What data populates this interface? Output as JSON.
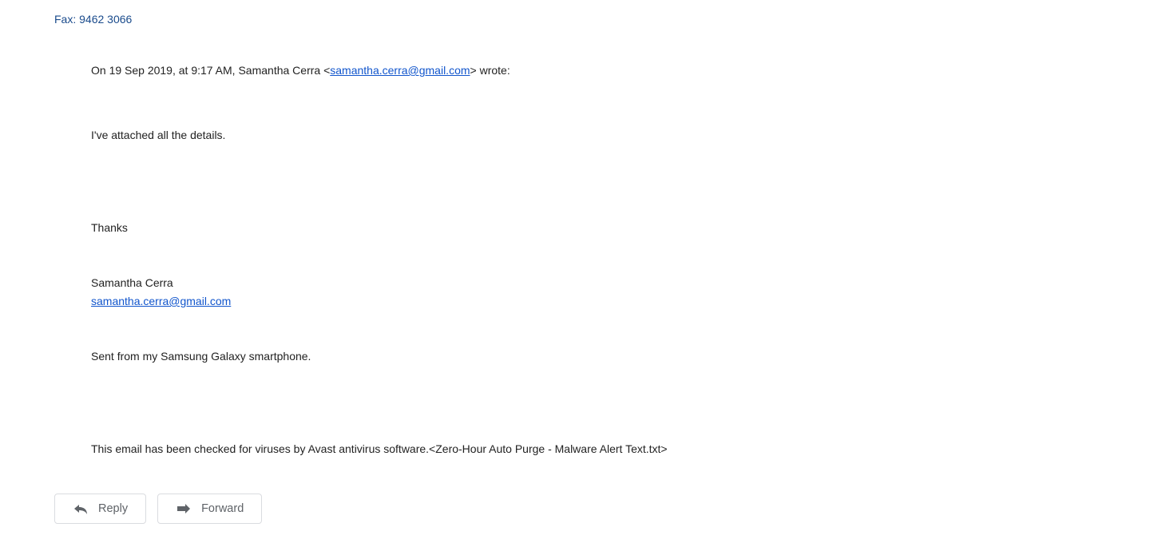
{
  "header": {
    "fax_line": "Fax: 9462 3066"
  },
  "quote": {
    "prefix": "On 19 Sep 2019, at 9:17 AM, Samantha Cerra <",
    "email": "samantha.cerra@gmail.com",
    "suffix": "> wrote:"
  },
  "body": {
    "attached": "I've attached all the details.",
    "thanks": "Thanks",
    "signature_name": "Samantha Cerra",
    "signature_email": "samantha.cerra@gmail.com",
    "sent_from": "Sent from my Samsung Galaxy smartphone.",
    "virus_check": "This email has been checked for viruses by Avast antivirus software.<Zero-Hour Auto Purge - Malware Alert Text.txt>"
  },
  "actions": {
    "reply_label": "Reply",
    "forward_label": "Forward"
  }
}
